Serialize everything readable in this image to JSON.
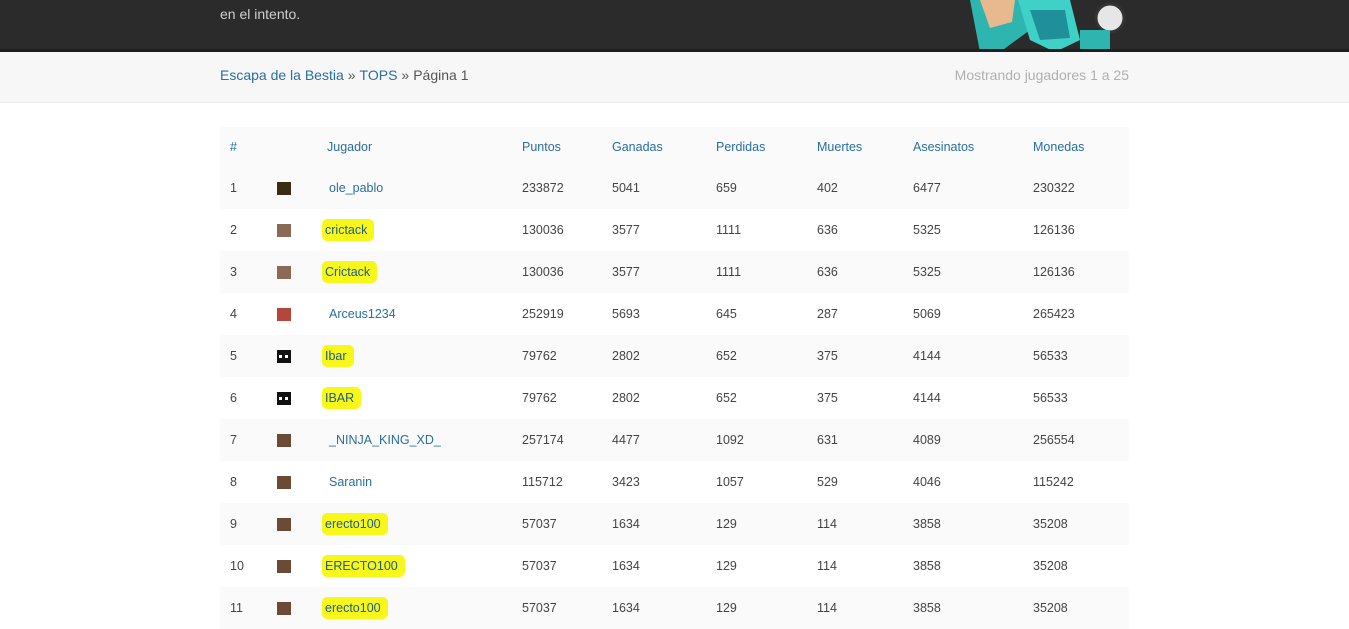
{
  "header": {
    "intro_text": "en el intento."
  },
  "breadcrumb": {
    "home": "Escapa de la Bestia",
    "sep1": "»",
    "section": "TOPS",
    "sep2": "»",
    "page": "Página 1"
  },
  "showing_text": "Mostrando jugadores 1 a 25",
  "table": {
    "columns": [
      "#",
      "",
      "Jugador",
      "Puntos",
      "Ganadas",
      "Perdidas",
      "Muertes",
      "Asesinatos",
      "Monedas"
    ],
    "rows": [
      {
        "rank": "1",
        "player": "ole_pablo",
        "points": "233872",
        "wins": "5041",
        "losses": "659",
        "deaths": "402",
        "kills": "6477",
        "coins": "230322",
        "highlight": false,
        "head": "#3b2a14"
      },
      {
        "rank": "2",
        "player": "crictack",
        "points": "130036",
        "wins": "3577",
        "losses": "1111",
        "deaths": "636",
        "kills": "5325",
        "coins": "126136",
        "highlight": true,
        "head": "#8a6a55"
      },
      {
        "rank": "3",
        "player": "Crictack",
        "points": "130036",
        "wins": "3577",
        "losses": "1111",
        "deaths": "636",
        "kills": "5325",
        "coins": "126136",
        "highlight": true,
        "head": "#8a6a55"
      },
      {
        "rank": "4",
        "player": "Arceus1234",
        "points": "252919",
        "wins": "5693",
        "losses": "645",
        "deaths": "287",
        "kills": "5069",
        "coins": "265423",
        "highlight": false,
        "head": "#b5463b"
      },
      {
        "rank": "5",
        "player": "Ibar",
        "points": "79762",
        "wins": "2802",
        "losses": "652",
        "deaths": "375",
        "kills": "4144",
        "coins": "56533",
        "highlight": true,
        "head": "#111111"
      },
      {
        "rank": "6",
        "player": "IBAR",
        "points": "79762",
        "wins": "2802",
        "losses": "652",
        "deaths": "375",
        "kills": "4144",
        "coins": "56533",
        "highlight": true,
        "head": "#111111"
      },
      {
        "rank": "7",
        "player": "_NINJA_KING_XD_",
        "points": "257174",
        "wins": "4477",
        "losses": "1092",
        "deaths": "631",
        "kills": "4089",
        "coins": "256554",
        "highlight": false,
        "head": "#6b4a36"
      },
      {
        "rank": "8",
        "player": "Saranin",
        "points": "115712",
        "wins": "3423",
        "losses": "1057",
        "deaths": "529",
        "kills": "4046",
        "coins": "115242",
        "highlight": false,
        "head": "#6b4a36"
      },
      {
        "rank": "9",
        "player": "erecto100",
        "points": "57037",
        "wins": "1634",
        "losses": "129",
        "deaths": "114",
        "kills": "3858",
        "coins": "35208",
        "highlight": true,
        "head": "#6b4a36"
      },
      {
        "rank": "10",
        "player": "ERECTO100",
        "points": "57037",
        "wins": "1634",
        "losses": "129",
        "deaths": "114",
        "kills": "3858",
        "coins": "35208",
        "highlight": true,
        "head": "#6b4a36"
      },
      {
        "rank": "11",
        "player": "erecto100",
        "points": "57037",
        "wins": "1634",
        "losses": "129",
        "deaths": "114",
        "kills": "3858",
        "coins": "35208",
        "highlight": true,
        "head": "#6b4a36"
      }
    ]
  },
  "colors": {
    "link": "#2a6f9e",
    "highlight": "#f7f71a",
    "topbar": "#2b2b2b"
  }
}
